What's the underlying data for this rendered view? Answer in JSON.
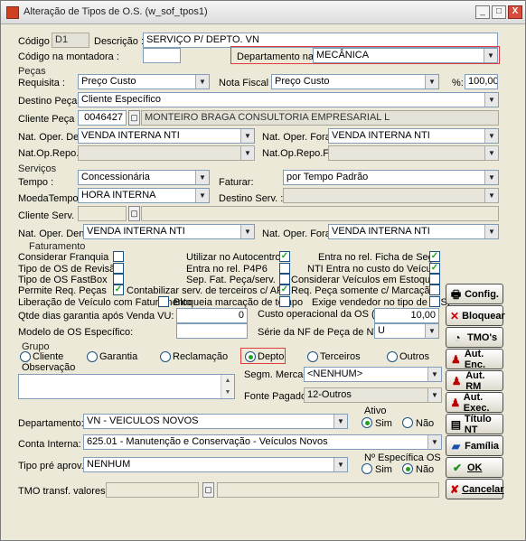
{
  "window": {
    "title": "Alteração de Tipos de O.S. (w_sof_tpos1)",
    "min": "_",
    "max": "□",
    "close": "X"
  },
  "header": {
    "codigo_label": "Código :",
    "codigo_value": "D1",
    "descricao_label": "Descrição :",
    "descricao_value": "SERVIÇO P/ DEPTO. VN",
    "codigo_montadora_label": "Código na montadora :",
    "codigo_montadora_value": "",
    "depto_nf_label": "Departamento na NF:",
    "depto_nf_value": "MECÂNICA"
  },
  "pecas": {
    "title": "Peças",
    "requisita_label": "Requisita :",
    "requisita_value": "Preço Custo",
    "nota_fiscal_label": "Nota Fiscal :",
    "nota_fiscal_value": "Preço Custo",
    "pct_label": "%:",
    "pct_value": "100,00",
    "destino_label": "Destino Peça :",
    "destino_value": "Cliente Específico",
    "cliente_label": "Cliente Peça :",
    "cliente_code": "0046427",
    "cliente_name": "MONTEIRO BRAGA CONSULTORIA EMPRESARIAL L",
    "nat_dentro_label": "Nat. Oper. Dentro:",
    "nat_dentro_value": "VENDA INTERNA NTI",
    "nat_fora_label": "Nat. Oper. Fora:",
    "nat_fora_value": "VENDA INTERNA NTI",
    "nat_repo_den_label": "Nat.Op.Repo.Den:",
    "nat_repo_den_value": "",
    "nat_repo_fora_label": "Nat.Op.Repo.Fora:",
    "nat_repo_fora_value": ""
  },
  "servicos": {
    "title": "Serviços",
    "tempo_label": "Tempo :",
    "tempo_value": "Concessionária",
    "faturar_label": "Faturar:",
    "faturar_value": "por Tempo Padrão",
    "moeda_label": "MoedaTempo :",
    "moeda_value": "HORA  INTERNA",
    "destino_serv_label": "Destino Serv. :",
    "destino_serv_value": "",
    "cliente_serv_label": "Cliente Serv. :",
    "cliente_serv_code": "",
    "cliente_serv_name": "",
    "nat_dentro_label": "Nat. Oper. Dentro:",
    "nat_dentro_value": "VENDA INTERNA NTI",
    "nat_fora_label": "Nat. Oper. Fora:",
    "nat_fora_value": "VENDA INTERNA NTI"
  },
  "faturamento": {
    "title": "Faturamento",
    "considerar_franquia": "Considerar Franquia",
    "tipo_os_revisao": "Tipo de OS de Revisão",
    "tipo_os_fastbox": "Tipo de OS FastBox",
    "permite_req_pecas": "Permite Req. Peças",
    "liberacao_veiculo": "Liberação de Veículo com Faturamento",
    "utilizar_autocentro": "Utilizar no Autocentro",
    "entra_p4p6": "Entra no rel. P4P6",
    "sep_fat_peca": "Sep. Fat. Peça/serv.",
    "contabilizar_terceiros": "Contabilizar serv. de terceiros c/ AF",
    "bloqueia_marcacao": "Bloqueia marcação de tempo",
    "entra_ficha_seg": "Entra no rel. Ficha de Seg.",
    "nti_entra_custo": "NTI Entra no custo do Veículo",
    "considerar_veiculos_estoque": "Considerar Veículos em Estoque",
    "req_peca_marcacao": "Req. Peça somente c/ Marcação",
    "exige_vendedor": "Exige vendedor no tipo de O.S.",
    "qtde_garantia_label": "Qtde dias garantia após Venda VU:",
    "qtde_garantia_value": "0",
    "custo_operacional_label": "Custo operacional da OS (%)",
    "custo_operacional_value": "10,00",
    "modelo_os_label": "Modelo de OS Específico:",
    "modelo_os_value": "",
    "serie_nf_label": "Série da NF de Peça de NTI",
    "serie_nf_value": "U"
  },
  "grupo": {
    "title": "Grupo",
    "options": [
      "Cliente",
      "Garantia",
      "Reclamação",
      "Depto",
      "Terceiros",
      "Outros"
    ],
    "selected": "Depto"
  },
  "observacao": {
    "label": "Observação",
    "value": ""
  },
  "segm": {
    "label": "Segm. Mercado:",
    "value": "<NENHUM>"
  },
  "fonte": {
    "label": "Fonte Pagadora:",
    "value": "12-Outros"
  },
  "departamento": {
    "label": "Departamento:",
    "value": "VN - VEICULOS NOVOS"
  },
  "ativo": {
    "label": "Ativo",
    "sim": "Sim",
    "nao": "Não"
  },
  "conta": {
    "label": "Conta Interna:",
    "value": "625.01 - Manutenção e Conservação - Veículos Novos"
  },
  "tipo_pre": {
    "label": "Tipo pré aprov.:",
    "value": "NENHUM"
  },
  "nro_especifica": {
    "label": "Nº Específica OS",
    "sim": "Sim",
    "nao": "Não"
  },
  "tmo": {
    "label": "TMO transf. valores:",
    "code": "",
    "name": ""
  },
  "buttons": {
    "config": "Config.",
    "bloquear": "Bloquear",
    "tmos": "TMO's",
    "aut_enc": "Aut. Enc.",
    "aut_rm": "Aut. RM",
    "aut_exec": "Aut. Exec.",
    "titulo_nt": "Título NT",
    "familia": "Família",
    "ok": "OK",
    "cancelar": "Cancelar"
  },
  "colors": {
    "check": "#21a121",
    "highlight": "#e03a3a"
  }
}
